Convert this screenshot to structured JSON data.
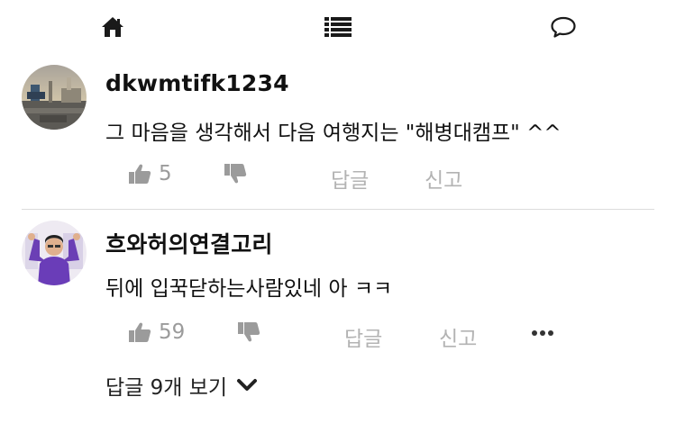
{
  "nav": {
    "items": [
      {
        "icon": "home-icon"
      },
      {
        "icon": "list-icon"
      },
      {
        "icon": "chat-bubble-icon"
      }
    ]
  },
  "comments": [
    {
      "username": "dkwmtifk1234",
      "text": "그 마음을 생각해서 다음 여행지는 \"해병대캠프\" ^^",
      "likes": "5",
      "reply_label": "답글",
      "report_label": "신고"
    },
    {
      "username": "흐와허의연결고리",
      "text": "뒤에 입꾹닫하는사람있네 아 ㅋㅋ",
      "likes": "59",
      "reply_label": "답글",
      "report_label": "신고",
      "view_replies_label": "답글 9개 보기"
    }
  ],
  "colors": {
    "text": "#111111",
    "muted": "#9b9b9b",
    "divider": "#dcdcdc",
    "icon": "#1a1a1a"
  }
}
